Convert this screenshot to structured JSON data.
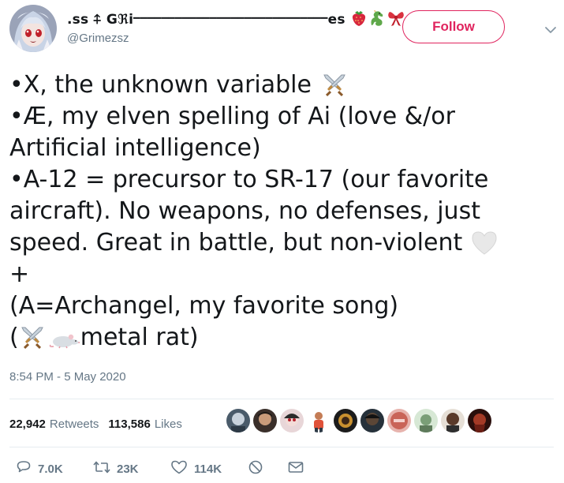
{
  "user": {
    "display_name": ".ꜱꜱ ⍏ Gℜiⲻⲻⲻⲻⲻⲻⲻⲻⲻⲻⲻⲻⲻⲻⲻⲻⲻⲻⲻⲻⲻⲻⲻⲻⲻⲻⲻⲻes",
    "handle": "@Grimezsz",
    "name_emojis": [
      "strawberry",
      "dragon",
      "ribbon"
    ],
    "ellipsis": "...",
    "verified": true
  },
  "follow_label": "Follow",
  "tweet": {
    "lines": [
      {
        "text": "•X, the unknown variable",
        "emoji_after": "crossed-swords"
      },
      {
        "text": "•Æ, my elven spelling of Ai (love &/or"
      },
      {
        "text": "Artificial intelligence)"
      },
      {
        "text": "•A-12 = precursor to SR-17 (our favorite"
      },
      {
        "text": "aircraft).  No weapons, no defenses, just"
      },
      {
        "text": "speed.  Great in battle, but non-violent",
        "emoji_after": "white-heart"
      },
      {
        "text": "+"
      },
      {
        "text": "(A=Archangel, my favorite song)"
      },
      {
        "text_before": "(",
        "emojis": [
          "crossed-swords",
          "rat"
        ],
        "text": " metal rat)"
      }
    ]
  },
  "timestamp": "8:54 PM - 5 May 2020",
  "stats": {
    "retweets_count": "22,942",
    "retweets_label": "Retweets",
    "likes_count": "113,586",
    "likes_label": "Likes"
  },
  "likers_count": 10,
  "actions": {
    "reply_count": "7.0K",
    "retweet_count": "23K",
    "like_count": "114K"
  },
  "colors": {
    "follow_accent": "#e0245e",
    "verified_blue": "#1da1f2",
    "secondary_text": "#657786",
    "divider": "#e6ecf0"
  }
}
